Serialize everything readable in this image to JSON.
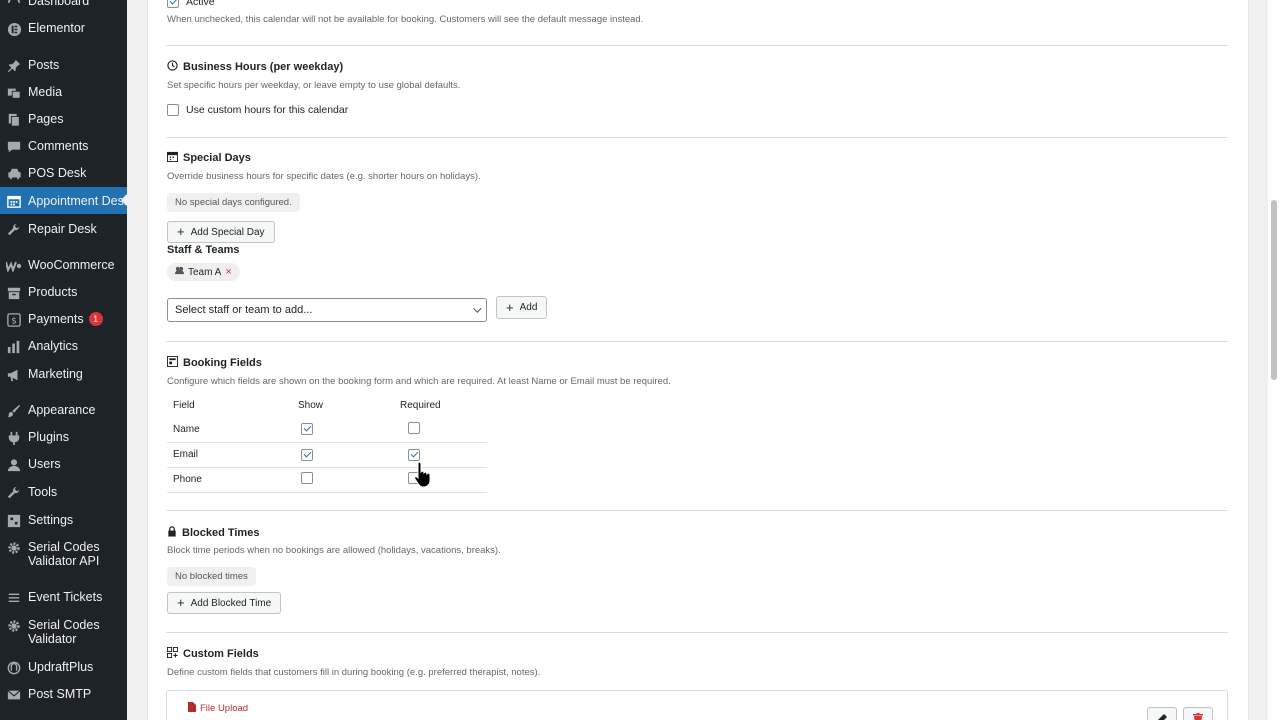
{
  "sidebar": {
    "items": [
      {
        "label": "Dashboard",
        "icon": "dashboard-icon"
      },
      {
        "label": "Elementor",
        "icon": "elementor-icon"
      },
      {
        "label": "Posts",
        "icon": "pin-icon"
      },
      {
        "label": "Media",
        "icon": "media-icon"
      },
      {
        "label": "Pages",
        "icon": "pages-icon"
      },
      {
        "label": "Comments",
        "icon": "comment-icon"
      },
      {
        "label": "POS Desk",
        "icon": "car-icon"
      },
      {
        "label": "Appointment Desk",
        "icon": "calendar-icon"
      },
      {
        "label": "Repair Desk",
        "icon": "wrench-icon"
      },
      {
        "label": "WooCommerce",
        "icon": "woo-icon"
      },
      {
        "label": "Products",
        "icon": "archive-icon"
      },
      {
        "label": "Payments",
        "icon": "dollar-icon",
        "badge": "1"
      },
      {
        "label": "Analytics",
        "icon": "bar-chart-icon"
      },
      {
        "label": "Marketing",
        "icon": "megaphone-icon"
      },
      {
        "label": "Appearance",
        "icon": "paintbrush-icon"
      },
      {
        "label": "Plugins",
        "icon": "plugin-icon"
      },
      {
        "label": "Users",
        "icon": "user-icon"
      },
      {
        "label": "Tools",
        "icon": "wrench-icon"
      },
      {
        "label": "Settings",
        "icon": "settings-icon"
      },
      {
        "label": "Serial Codes Validator API",
        "icon": "gear-icon"
      },
      {
        "label": "Event Tickets",
        "icon": "list-icon"
      },
      {
        "label": "Serial Codes Validator",
        "icon": "gear-icon"
      },
      {
        "label": "UpdraftPlus",
        "icon": "updraft-icon"
      },
      {
        "label": "Post SMTP",
        "icon": "mail-icon"
      }
    ]
  },
  "active": {
    "checkbox_label": "Active",
    "checked": true,
    "description": "When unchecked, this calendar will not be available for booking. Customers will see the default message instead."
  },
  "business_hours": {
    "title": "Business Hours (per weekday)",
    "description": "Set specific hours per weekday, or leave empty to use global defaults.",
    "checkbox_label": "Use custom hours for this calendar",
    "checked": false
  },
  "special_days": {
    "title": "Special Days",
    "description": "Override business hours for specific dates (e.g. shorter hours on holidays).",
    "empty": "No special days configured.",
    "add_button": "Add Special Day"
  },
  "staff": {
    "title": "Staff & Teams",
    "chips": [
      {
        "label": "Team A"
      }
    ],
    "select_placeholder": "Select staff or team to add...",
    "add_button": "Add"
  },
  "booking_fields": {
    "title": "Booking Fields",
    "description": "Configure which fields are shown on the booking form and which are required. At least Name or Email must be required.",
    "columns": [
      "Field",
      "Show",
      "Required"
    ],
    "rows": [
      {
        "field": "Name",
        "show": true,
        "required": false
      },
      {
        "field": "Email",
        "show": true,
        "required": true
      },
      {
        "field": "Phone",
        "show": false,
        "required": false
      }
    ]
  },
  "blocked_times": {
    "title": "Blocked Times",
    "description": "Block time periods when no bookings are allowed (holidays, vacations, breaks).",
    "empty": "No blocked times",
    "add_button": "Add Blocked Time"
  },
  "custom_fields": {
    "title": "Custom Fields",
    "description": "Define custom fields that customers fill in during booking (e.g. preferred therapist, notes).",
    "items": [
      {
        "type_label": "File Upload"
      }
    ]
  },
  "colors": {
    "accent": "#2271b1",
    "sidebar_bg": "#1d2327",
    "danger": "#d63638"
  }
}
